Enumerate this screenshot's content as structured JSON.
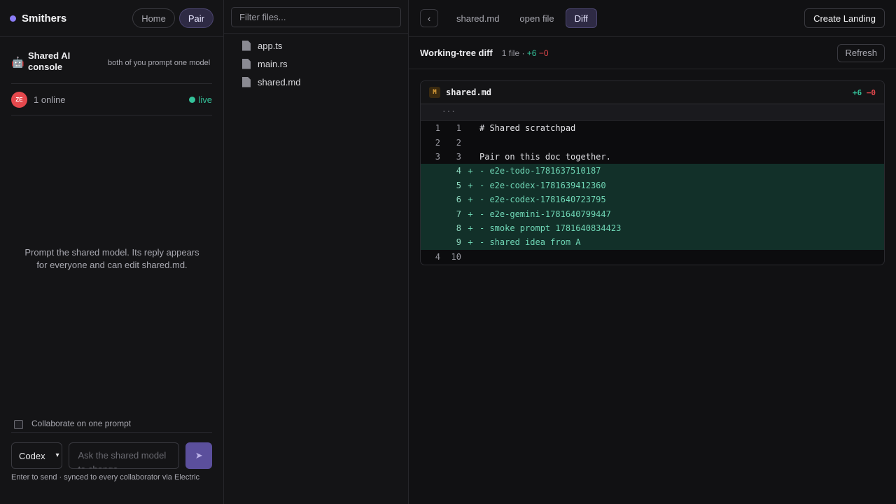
{
  "brand": {
    "name": "Smithers",
    "accent": "#8b7cf6"
  },
  "nav": {
    "home": "Home",
    "pair": "Pair"
  },
  "console": {
    "icon": "robot-icon",
    "title": "Shared AI console",
    "subtitle": "both of you prompt one model"
  },
  "presence": {
    "avatar": "ZE",
    "online": "1 online",
    "status": "live"
  },
  "empty_state": "Prompt the shared model. Its reply appears for everyone and can edit shared.md.",
  "collab": {
    "label": "Collaborate on one prompt",
    "checked": false
  },
  "composer": {
    "model": "Codex",
    "placeholder": "Ask the shared model to change",
    "send_icon": "send-icon",
    "hint": "Enter to send · synced to every collaborator via Electric"
  },
  "files": {
    "filter_placeholder": "Filter files...",
    "items": [
      {
        "name": "app.ts"
      },
      {
        "name": "main.rs"
      },
      {
        "name": "shared.md"
      }
    ]
  },
  "tabs": {
    "back": "‹",
    "items": [
      {
        "label": "shared.md",
        "active": false
      },
      {
        "label": "open file",
        "active": false
      },
      {
        "label": "Diff",
        "active": true
      }
    ],
    "create_landing": "Create Landing"
  },
  "diff": {
    "title": "Working-tree diff",
    "meta_prefix": "1 file ·",
    "added": "+6",
    "removed": "−0",
    "refresh": "Refresh",
    "file": {
      "badge": "M",
      "name": "shared.md",
      "added": "+6",
      "removed": "−0",
      "hunk": "···",
      "lines": [
        {
          "old": "1",
          "new": "1",
          "sign": "",
          "text": "# Shared scratchpad",
          "type": "context"
        },
        {
          "old": "2",
          "new": "2",
          "sign": "",
          "text": "",
          "type": "context"
        },
        {
          "old": "3",
          "new": "3",
          "sign": "",
          "text": "Pair on this doc together.",
          "type": "context"
        },
        {
          "old": "",
          "new": "4",
          "sign": "+",
          "text": "- e2e-todo-1781637510187",
          "type": "added"
        },
        {
          "old": "",
          "new": "5",
          "sign": "+",
          "text": "- e2e-codex-1781639412360",
          "type": "added"
        },
        {
          "old": "",
          "new": "6",
          "sign": "+",
          "text": "- e2e-codex-1781640723795",
          "type": "added"
        },
        {
          "old": "",
          "new": "7",
          "sign": "+",
          "text": "- e2e-gemini-1781640799447",
          "type": "added"
        },
        {
          "old": "",
          "new": "8",
          "sign": "+",
          "text": "- smoke prompt 1781640834423",
          "type": "added"
        },
        {
          "old": "",
          "new": "9",
          "sign": "+",
          "text": "- shared idea from A",
          "type": "added"
        },
        {
          "old": "4",
          "new": "10",
          "sign": "",
          "text": "",
          "type": "context"
        }
      ]
    }
  }
}
